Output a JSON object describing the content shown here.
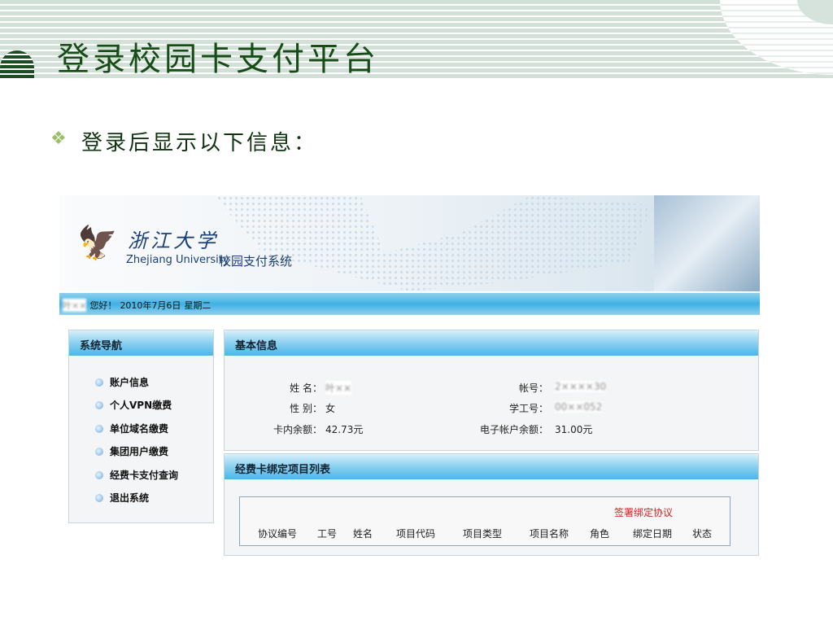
{
  "slide": {
    "title": "登录校园卡支付平台",
    "bullet": "登录后显示以下信息："
  },
  "app": {
    "logo_cn": "浙江大学",
    "logo_en": "Zhejiang University",
    "system_name": "校园支付系统",
    "greeting": {
      "user": "叶××",
      "text": "您好！",
      "date": "2010年7月6日",
      "weekday": "星期二"
    },
    "nav": {
      "title": "系统导航",
      "items": [
        "账户信息",
        "个人VPN缴费",
        "单位域名缴费",
        "集团用户缴费",
        "经费卡支付查询",
        "退出系统"
      ]
    },
    "basic_info": {
      "title": "基本信息",
      "fields": [
        {
          "label": "姓 名：",
          "value": "叶××"
        },
        {
          "label": "性 别：",
          "value": "女"
        },
        {
          "label": "卡内余额：",
          "value": "42.73元"
        },
        {
          "label": "帐号：",
          "value": "2××××30"
        },
        {
          "label": "学工号：",
          "value": "00××052"
        },
        {
          "label": "电子帐户余额：",
          "value": "31.00元"
        }
      ]
    },
    "project_list": {
      "title": "经费卡绑定项目列表",
      "sign_link": "签署绑定协议",
      "columns": [
        "协议编号",
        "工号",
        "姓名",
        "项目代码",
        "项目类型",
        "项目名称",
        "角色",
        "绑定日期",
        "状态"
      ]
    }
  }
}
